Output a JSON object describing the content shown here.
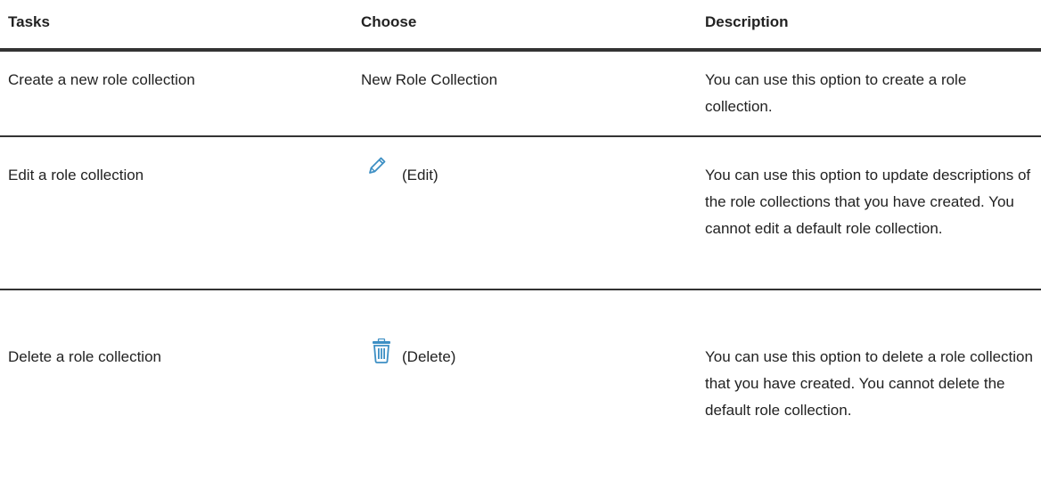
{
  "columns": {
    "tasks": "Tasks",
    "choose": "Choose",
    "description": "Description"
  },
  "rows": [
    {
      "task": "Create a new role collection",
      "choose": "New Role Collection",
      "icon": "",
      "description": "You can use this option to create a role collection."
    },
    {
      "task": "Edit a role collection",
      "choose": "(Edit)",
      "icon": "pencil-icon",
      "description": "You can use this option to update descriptions of the role collections that you have created. You cannot edit a default role collection."
    },
    {
      "task": "Delete a role collection",
      "choose": "(Delete)",
      "icon": "trash-icon",
      "description": "You can use this option to delete a role collection that you have created. You cannot delete the default role collection."
    }
  ],
  "colors": {
    "text": "#222222",
    "rule": "#333333",
    "icon": "#3d8fc4"
  }
}
